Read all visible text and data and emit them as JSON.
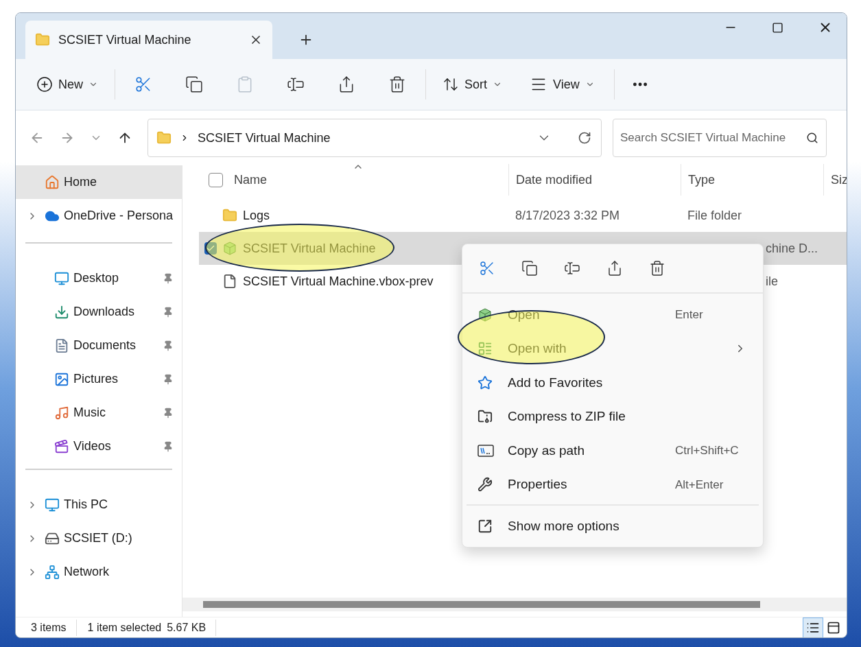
{
  "window": {
    "tab_title": "SCSIET Virtual Machine"
  },
  "toolbar": {
    "new_label": "New",
    "icon_buttons": [
      {
        "disabled": false
      },
      {
        "disabled": false
      },
      {
        "disabled": true
      },
      {
        "disabled": false
      },
      {
        "disabled": false
      },
      {
        "disabled": false
      }
    ],
    "sort_label": "Sort",
    "view_label": "View"
  },
  "address_bar": {
    "path": "SCSIET Virtual Machine"
  },
  "search": {
    "placeholder": "Search SCSIET Virtual Machine"
  },
  "sidebar": {
    "sections": [
      {
        "items": [
          {
            "label": "Home",
            "selected": true,
            "expandable": false,
            "pinned": false
          },
          {
            "label": "OneDrive - Persona",
            "selected": false,
            "expandable": true,
            "pinned": false
          }
        ]
      },
      {
        "items": [
          {
            "label": "Desktop",
            "selected": false,
            "expandable": false,
            "pinned": true
          },
          {
            "label": "Downloads",
            "selected": false,
            "expandable": false,
            "pinned": true
          },
          {
            "label": "Documents",
            "selected": false,
            "expandable": false,
            "pinned": true
          },
          {
            "label": "Pictures",
            "selected": false,
            "expandable": false,
            "pinned": true
          },
          {
            "label": "Music",
            "selected": false,
            "expandable": false,
            "pinned": true
          },
          {
            "label": "Videos",
            "selected": false,
            "expandable": false,
            "pinned": true
          }
        ]
      },
      {
        "items": [
          {
            "label": "This PC",
            "selected": false,
            "expandable": true,
            "pinned": false
          },
          {
            "label": "SCSIET (D:)",
            "selected": false,
            "expandable": true,
            "pinned": false
          },
          {
            "label": "Network",
            "selected": false,
            "expandable": true,
            "pinned": false
          }
        ]
      }
    ]
  },
  "file_list": {
    "columns": [
      "Name",
      "Date modified",
      "Type",
      "Siz"
    ],
    "all_checked": false,
    "rows": [
      {
        "name": "Logs",
        "date": "8/17/2023 3:32 PM",
        "type": "File folder",
        "selected": false
      },
      {
        "name": "SCSIET Virtual Machine",
        "type": "chine D...",
        "selected": true
      },
      {
        "name": "SCSIET Virtual Machine.vbox-prev",
        "type": "ile",
        "selected": false
      }
    ]
  },
  "context_menu": {
    "items": [
      {
        "label": "Open",
        "shortcut": "Enter",
        "has_submenu": false
      },
      {
        "label": "Open with",
        "has_submenu": true
      },
      {
        "label": "Add to Favorites",
        "has_submenu": false
      },
      {
        "label": "Compress to ZIP file",
        "has_submenu": false
      },
      {
        "label": "Copy as path",
        "shortcut": "Ctrl+Shift+C",
        "has_submenu": false
      },
      {
        "label": "Properties",
        "shortcut": "Alt+Enter",
        "has_submenu": false
      }
    ],
    "more_options": "Show more options"
  },
  "status_bar": {
    "item_count": "3 items",
    "selection": "1 item selected",
    "size": "5.67 KB",
    "details_view": true
  }
}
